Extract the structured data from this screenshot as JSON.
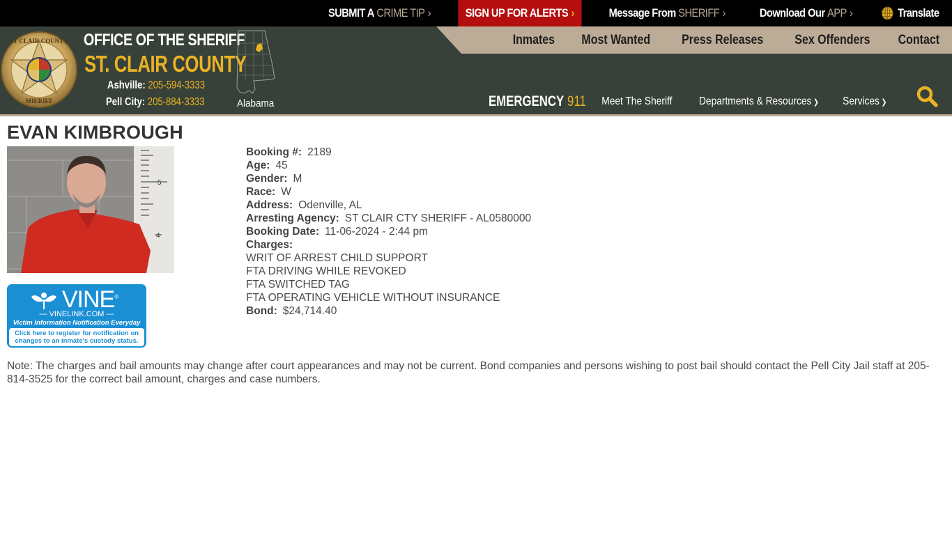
{
  "topbar": {
    "links": [
      {
        "main": "SUBMIT A",
        "accent": "CRIME TIP",
        "chevron": "›"
      },
      {
        "main": "SIGN UP FOR ALERTS",
        "accent": "",
        "chevron": "›"
      },
      {
        "main": "Message From",
        "accent": "SHERIFF",
        "chevron": "›"
      },
      {
        "main": "Download Our",
        "accent": "APP",
        "chevron": "›"
      }
    ],
    "translate": {
      "label": "Translate",
      "icon": "globe-icon"
    }
  },
  "header": {
    "title_line1": "OFFICE OF THE SHERIFF",
    "title_line2": "ST. CLAIR COUNTY",
    "phones": [
      {
        "label": "Ashville:",
        "number": "205-594-3333"
      },
      {
        "label": "Pell City:",
        "number": "205-884-3333"
      }
    ],
    "state_label": "Alabama",
    "badge_icon": "sheriff-badge-icon",
    "map_icon": "alabama-map-icon"
  },
  "utility_nav": [
    "Inmates",
    "Most Wanted",
    "Press Releases",
    "Sex Offenders",
    "Contact"
  ],
  "main_nav": {
    "emergency_label": "EMERGENCY",
    "emergency_number": "911",
    "items": [
      {
        "label": "Meet The Sheriff",
        "dropdown": false
      },
      {
        "label": "Departments & Resources",
        "dropdown": true
      },
      {
        "label": "Services",
        "dropdown": true
      }
    ],
    "search_icon": "search-icon"
  },
  "inmate": {
    "name": "EVAN KIMBROUGH",
    "fields": [
      {
        "label": "Booking #:",
        "value": "2189"
      },
      {
        "label": "Age:",
        "value": "45"
      },
      {
        "label": "Gender:",
        "value": "M"
      },
      {
        "label": "Race:",
        "value": "W"
      },
      {
        "label": "Address:",
        "value": "Odenville, AL"
      },
      {
        "label": "Arresting Agency:",
        "value": "ST CLAIR CTY SHERIFF - AL0580000"
      },
      {
        "label": "Booking Date:",
        "value": "11-06-2024 - 2:44 pm"
      }
    ],
    "charges_label": "Charges:",
    "charges": [
      "WRIT OF ARREST CHILD SUPPORT",
      "FTA DRIVING WHILE REVOKED",
      "FTA SWITCHED TAG",
      "FTA OPERATING VEHICLE WITHOUT INSURANCE"
    ],
    "bond_label": "Bond:",
    "bond_value": "$24,714.40",
    "mugshot_scale": [
      "5",
      "4"
    ]
  },
  "vine": {
    "logo": "VINE",
    "registered": "®",
    "url": "— VINELINK.COM —",
    "tagline": "Victim Information Notification Everyday",
    "cta_line1": "Click here to register for notification on",
    "cta_line2": "changes to an inmate's custody status."
  },
  "note": "Note: The charges and bail amounts may change after court appearances and may not be current. Bond companies and persons wishing to post bail should contact the Pell City Jail staff at 205-814-3525 for the correct bail amount, charges and case numbers."
}
